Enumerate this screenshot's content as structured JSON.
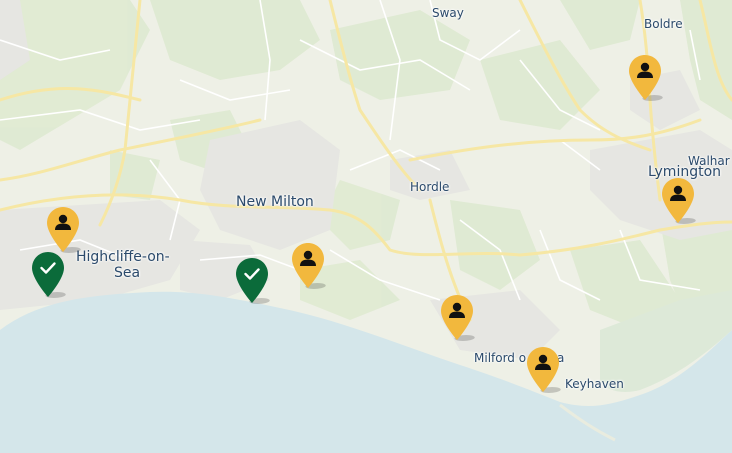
{
  "map": {
    "colors": {
      "sea": "#d4e6ea",
      "land": "#eef0e6",
      "greenery": "#dfead2",
      "road_major": "#f6e7a4",
      "road_minor": "#ffffff",
      "urban": "#e7e7e4",
      "label": "#2b4a6b",
      "marker_person": "#f2b83d",
      "marker_check": "#0b6b3a"
    },
    "places": [
      {
        "id": "sway",
        "name": "Sway"
      },
      {
        "id": "boldre",
        "name": "Boldre"
      },
      {
        "id": "lymington",
        "name": "Lymington"
      },
      {
        "id": "walhampton",
        "name": "Walhar"
      },
      {
        "id": "new-milton",
        "name": "New Milton"
      },
      {
        "id": "hordle",
        "name": "Hordle"
      },
      {
        "id": "highcliffe-1",
        "name": "Highcliffe-on-"
      },
      {
        "id": "highcliffe-2",
        "name": "Sea"
      },
      {
        "id": "milford",
        "name": "Milford o"
      },
      {
        "id": "milford-end",
        "name": "a"
      },
      {
        "id": "keyhaven",
        "name": "Keyhaven"
      }
    ],
    "markers": [
      {
        "id": "person-boldre",
        "type": "person",
        "icon": "person-icon"
      },
      {
        "id": "person-lymington",
        "type": "person",
        "icon": "person-icon"
      },
      {
        "id": "person-highcliffe",
        "type": "person",
        "icon": "person-icon"
      },
      {
        "id": "person-barton",
        "type": "person",
        "icon": "person-icon"
      },
      {
        "id": "person-milford-north",
        "type": "person",
        "icon": "person-icon"
      },
      {
        "id": "person-milford",
        "type": "person",
        "icon": "person-icon"
      },
      {
        "id": "check-highcliffe",
        "type": "check",
        "icon": "check-icon"
      },
      {
        "id": "check-barton",
        "type": "check",
        "icon": "check-icon"
      }
    ]
  }
}
